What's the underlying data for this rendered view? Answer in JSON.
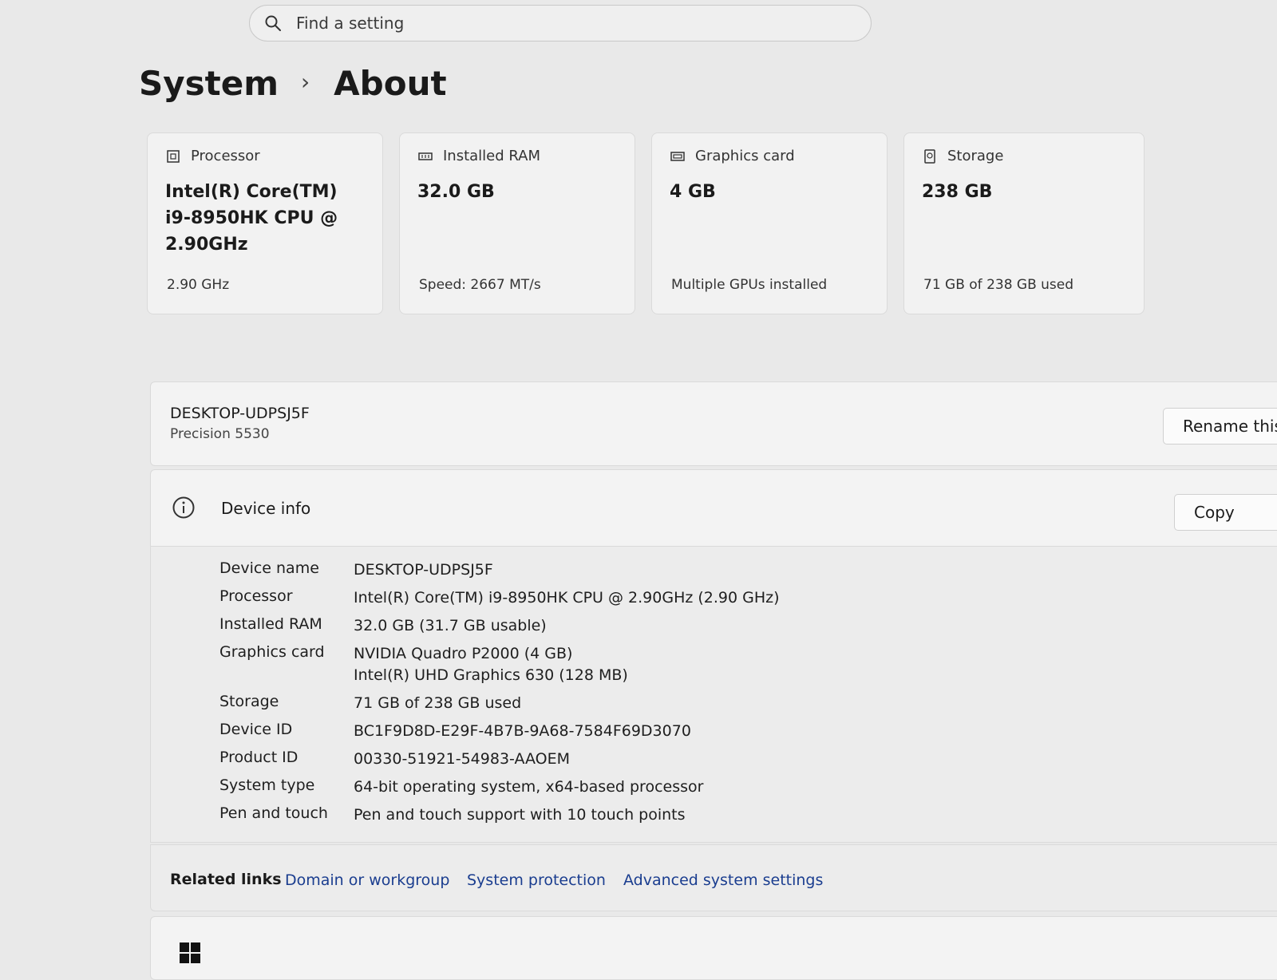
{
  "search": {
    "placeholder": "Find a setting",
    "icon": "search-icon"
  },
  "breadcrumb": {
    "parent": "System",
    "separator": "›",
    "current": "About"
  },
  "cards": [
    {
      "icon": "processor-icon",
      "title": "Processor",
      "value": "Intel(R) Core(TM) i9-8950HK CPU @ 2.90GHz",
      "sub": "2.90 GHz"
    },
    {
      "icon": "ram-icon",
      "title": "Installed RAM",
      "value": "32.0 GB",
      "sub": "Speed: 2667 MT/s"
    },
    {
      "icon": "graphics-card-icon",
      "title": "Graphics card",
      "value": "4 GB",
      "sub": "Multiple GPUs installed"
    },
    {
      "icon": "storage-icon",
      "title": "Storage",
      "value": "238 GB",
      "sub": "71 GB of 238 GB used"
    }
  ],
  "device": {
    "name": "DESKTOP-UDPSJ5F",
    "model": "Precision 5530",
    "rename_label": "Rename this"
  },
  "device_info": {
    "icon": "info-icon",
    "title": "Device info",
    "copy_label": "Copy",
    "rows": [
      {
        "key": "Device name",
        "value": "DESKTOP-UDPSJ5F"
      },
      {
        "key": "Processor",
        "value": "Intel(R) Core(TM) i9-8950HK CPU @ 2.90GHz (2.90 GHz)"
      },
      {
        "key": "Installed RAM",
        "value": "32.0 GB (31.7 GB usable)"
      },
      {
        "key": "Graphics card",
        "value": "NVIDIA Quadro P2000 (4 GB)",
        "value2": "Intel(R) UHD Graphics 630 (128 MB)"
      },
      {
        "key": "Storage",
        "value": "71 GB of 238 GB used"
      },
      {
        "key": "Device ID",
        "value": "BC1F9D8D-E29F-4B7B-9A68-7584F69D3070"
      },
      {
        "key": "Product ID",
        "value": "00330-51921-54983-AAOEM"
      },
      {
        "key": "System type",
        "value": "64-bit operating system, x64-based processor"
      },
      {
        "key": "Pen and touch",
        "value": "Pen and touch support with 10 touch points"
      }
    ]
  },
  "related_links": {
    "label": "Related links",
    "links": [
      "Domain or workgroup",
      "System protection",
      "Advanced system settings"
    ]
  },
  "windows_spec": {
    "icon": "windows-logo-icon"
  },
  "colors": {
    "background": "#e9e9e9",
    "panel": "#f3f3f3",
    "link": "#1a3d8f"
  }
}
